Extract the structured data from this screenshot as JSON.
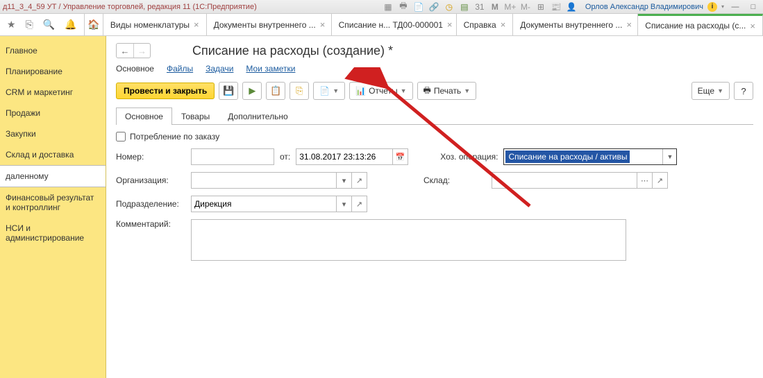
{
  "titlebar": {
    "title": "д11_3_4_59 УТ / Управление торговлей, редакция 11  (1С:Предприятие)",
    "user": "Орлов Александр Владимирович",
    "m": "M",
    "mplus": "M+",
    "mminus": "M-"
  },
  "tabs": [
    {
      "label": "Виды номенклатуры"
    },
    {
      "label": "Документы внутреннего ..."
    },
    {
      "label": "Списание н... ТД00-000001"
    },
    {
      "label": "Справка"
    },
    {
      "label": "Документы внутреннего ..."
    },
    {
      "label": "Списание на расходы (с..."
    }
  ],
  "sidebar": {
    "items": [
      "Главное",
      "Планирование",
      "CRM и маркетинг",
      "Продажи",
      "Закупки",
      "Склад и доставка",
      "даленному",
      "Финансовый результат и контроллинг",
      "НСИ и администрирование"
    ]
  },
  "page": {
    "title": "Списание на расходы (создание) *",
    "subnav": [
      "Основное",
      "Файлы",
      "Задачи",
      "Мои заметки"
    ],
    "toolbar": {
      "post_close": "Провести и закрыть",
      "reports": "Отчеты",
      "print": "Печать",
      "more": "Еще"
    },
    "formtabs": [
      "Основное",
      "Товары",
      "Дополнительно"
    ],
    "fields": {
      "consume_by_order": "Потребление по заказу",
      "number_label": "Номер:",
      "number_value": "",
      "from_label": "от:",
      "date_value": "31.08.2017 23:13:26",
      "operation_label": "Хоз. операция:",
      "operation_value": "Списание на расходы / активы",
      "org_label": "Организация:",
      "org_value": "",
      "warehouse_label": "Склад:",
      "warehouse_value": "",
      "dept_label": "Подразделение:",
      "dept_value": "Дирекция",
      "comment_label": "Комментарий:",
      "comment_value": ""
    }
  }
}
